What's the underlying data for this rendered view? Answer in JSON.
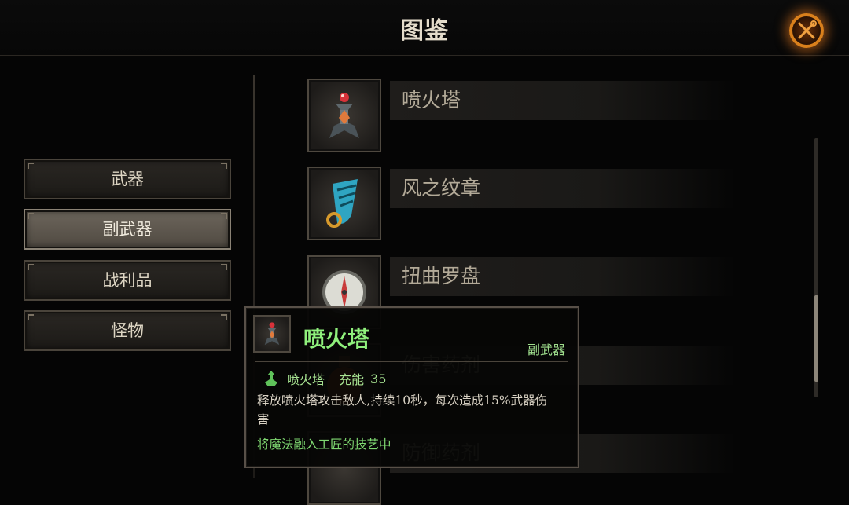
{
  "header": {
    "title": "图鉴"
  },
  "tabs": [
    {
      "label": "武器",
      "active": false
    },
    {
      "label": "副武器",
      "active": true
    },
    {
      "label": "战利品",
      "active": false
    },
    {
      "label": "怪物",
      "active": false
    }
  ],
  "items": [
    {
      "name": "喷火塔",
      "icon": "flame-tower-icon"
    },
    {
      "name": "风之纹章",
      "icon": "wind-emblem-icon"
    },
    {
      "name": "扭曲罗盘",
      "icon": "compass-icon"
    },
    {
      "name": "伤害药剂",
      "icon": "damage-potion-icon"
    },
    {
      "name": "防御药剂",
      "icon": "defense-potion-icon"
    }
  ],
  "tooltip": {
    "title": "喷火塔",
    "type": "副武器",
    "skill_name": "喷火塔",
    "charge_label": "充能",
    "charge_value": "35",
    "description": "释放喷火塔攻击敌人,持续10秒，每次造成15%武器伤害",
    "flavor": "将魔法融入工匠的技艺中"
  },
  "colors": {
    "accent_orange": "#d9801c",
    "tooltip_title": "#8ff07c",
    "flavor_green": "#7fd871"
  }
}
